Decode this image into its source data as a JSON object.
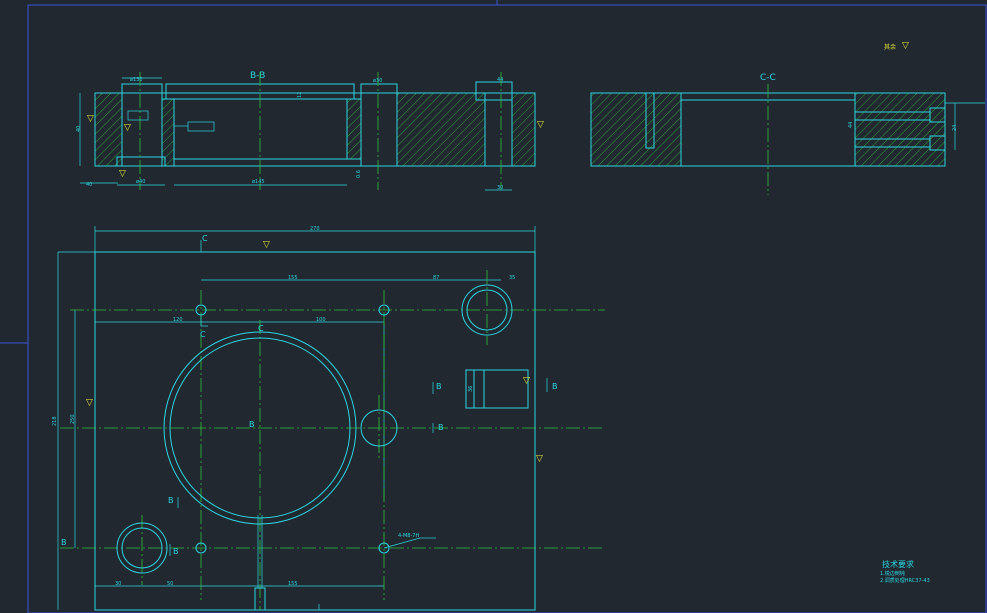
{
  "section_titles": {
    "bb": "B-B",
    "cc": "C-C"
  },
  "section_letters": {
    "c": "C",
    "b": "B",
    "bar": "B"
  },
  "dimensions": {
    "width_270": "270",
    "d155_top": "155",
    "d87": "87",
    "d35": "35",
    "d120": "120",
    "d100": "100",
    "height_218": "218",
    "height_250": "250",
    "d30": "30",
    "d50": "50",
    "d155_bottom": "155",
    "bb_phi130": "ø130",
    "bb_phi145": "ø145",
    "bb_phi30": "ø30",
    "bb_phi40": "ø40",
    "bb_44": "44",
    "bb_30": "30",
    "bb_40": "40",
    "bb_12": "12",
    "bb_06": "0.6",
    "bb_h": "40",
    "cc_44": "44",
    "cc_24": "24",
    "hole_note": "4-M8-7H",
    "bore_36": "36"
  },
  "roughness_marks": {
    "rest": "其余",
    "symbol": "▽"
  },
  "tech_notes": {
    "title": "技术要求",
    "line1": "1.锐边倒钝",
    "line2": "2.调质处理HRC37-43"
  }
}
